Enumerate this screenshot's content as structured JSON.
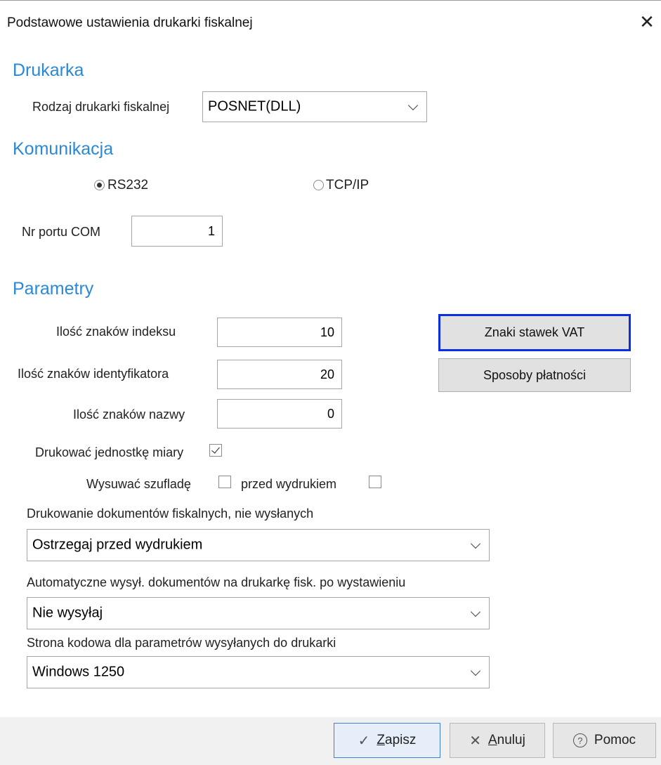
{
  "window": {
    "title": "Podstawowe ustawienia drukarki fiskalnej",
    "close_glyph": "✕"
  },
  "sections": {
    "printer": "Drukarka",
    "communication": "Komunikacja",
    "parameters": "Parametry"
  },
  "printer": {
    "type_label": "Rodzaj drukarki fiskalnej",
    "type_value": "POSNET(DLL)"
  },
  "communication": {
    "rs232_label": "RS232",
    "tcpip_label": "TCP/IP",
    "selected": "RS232",
    "com_port_label": "Nr portu COM",
    "com_port_value": "1"
  },
  "parameters": {
    "index_chars_label": "Ilość znaków indeksu",
    "index_chars_value": "10",
    "identifier_chars_label": "Ilość znaków identyfikatora",
    "identifier_chars_value": "20",
    "name_chars_label": "Ilość znaków nazwy",
    "name_chars_value": "0",
    "print_unit_label": "Drukować jednostkę miary",
    "print_unit_checked": true,
    "open_drawer_label": "Wysuwać szufladę",
    "open_drawer_checked": false,
    "before_print_label": "przed wydrukiem",
    "before_print_checked": false,
    "vat_button": "Znaki stawek VAT",
    "payment_button": "Sposoby płatności",
    "unsent_label": "Drukowanie dokumentów fiskalnych, nie wysłanych",
    "unsent_value": "Ostrzegaj przed wydrukiem",
    "auto_send_label": "Automatyczne wysył. dokumentów na drukarkę fisk. po wystawieniu",
    "auto_send_value": "Nie wysyłaj",
    "codepage_label": "Strona kodowa dla parametrów wysyłanych do drukarki",
    "codepage_value": "Windows 1250"
  },
  "footer": {
    "save_prefix": "",
    "save_accel": "Z",
    "save_rest": "apisz",
    "cancel_accel": "A",
    "cancel_rest": "nuluj",
    "help_label": "Pomoc"
  },
  "icons": {
    "save": "check-icon",
    "cancel": "x-icon",
    "help": "help-circle-icon",
    "accent": "#2b88d8",
    "focus": "#0b2fe0"
  }
}
